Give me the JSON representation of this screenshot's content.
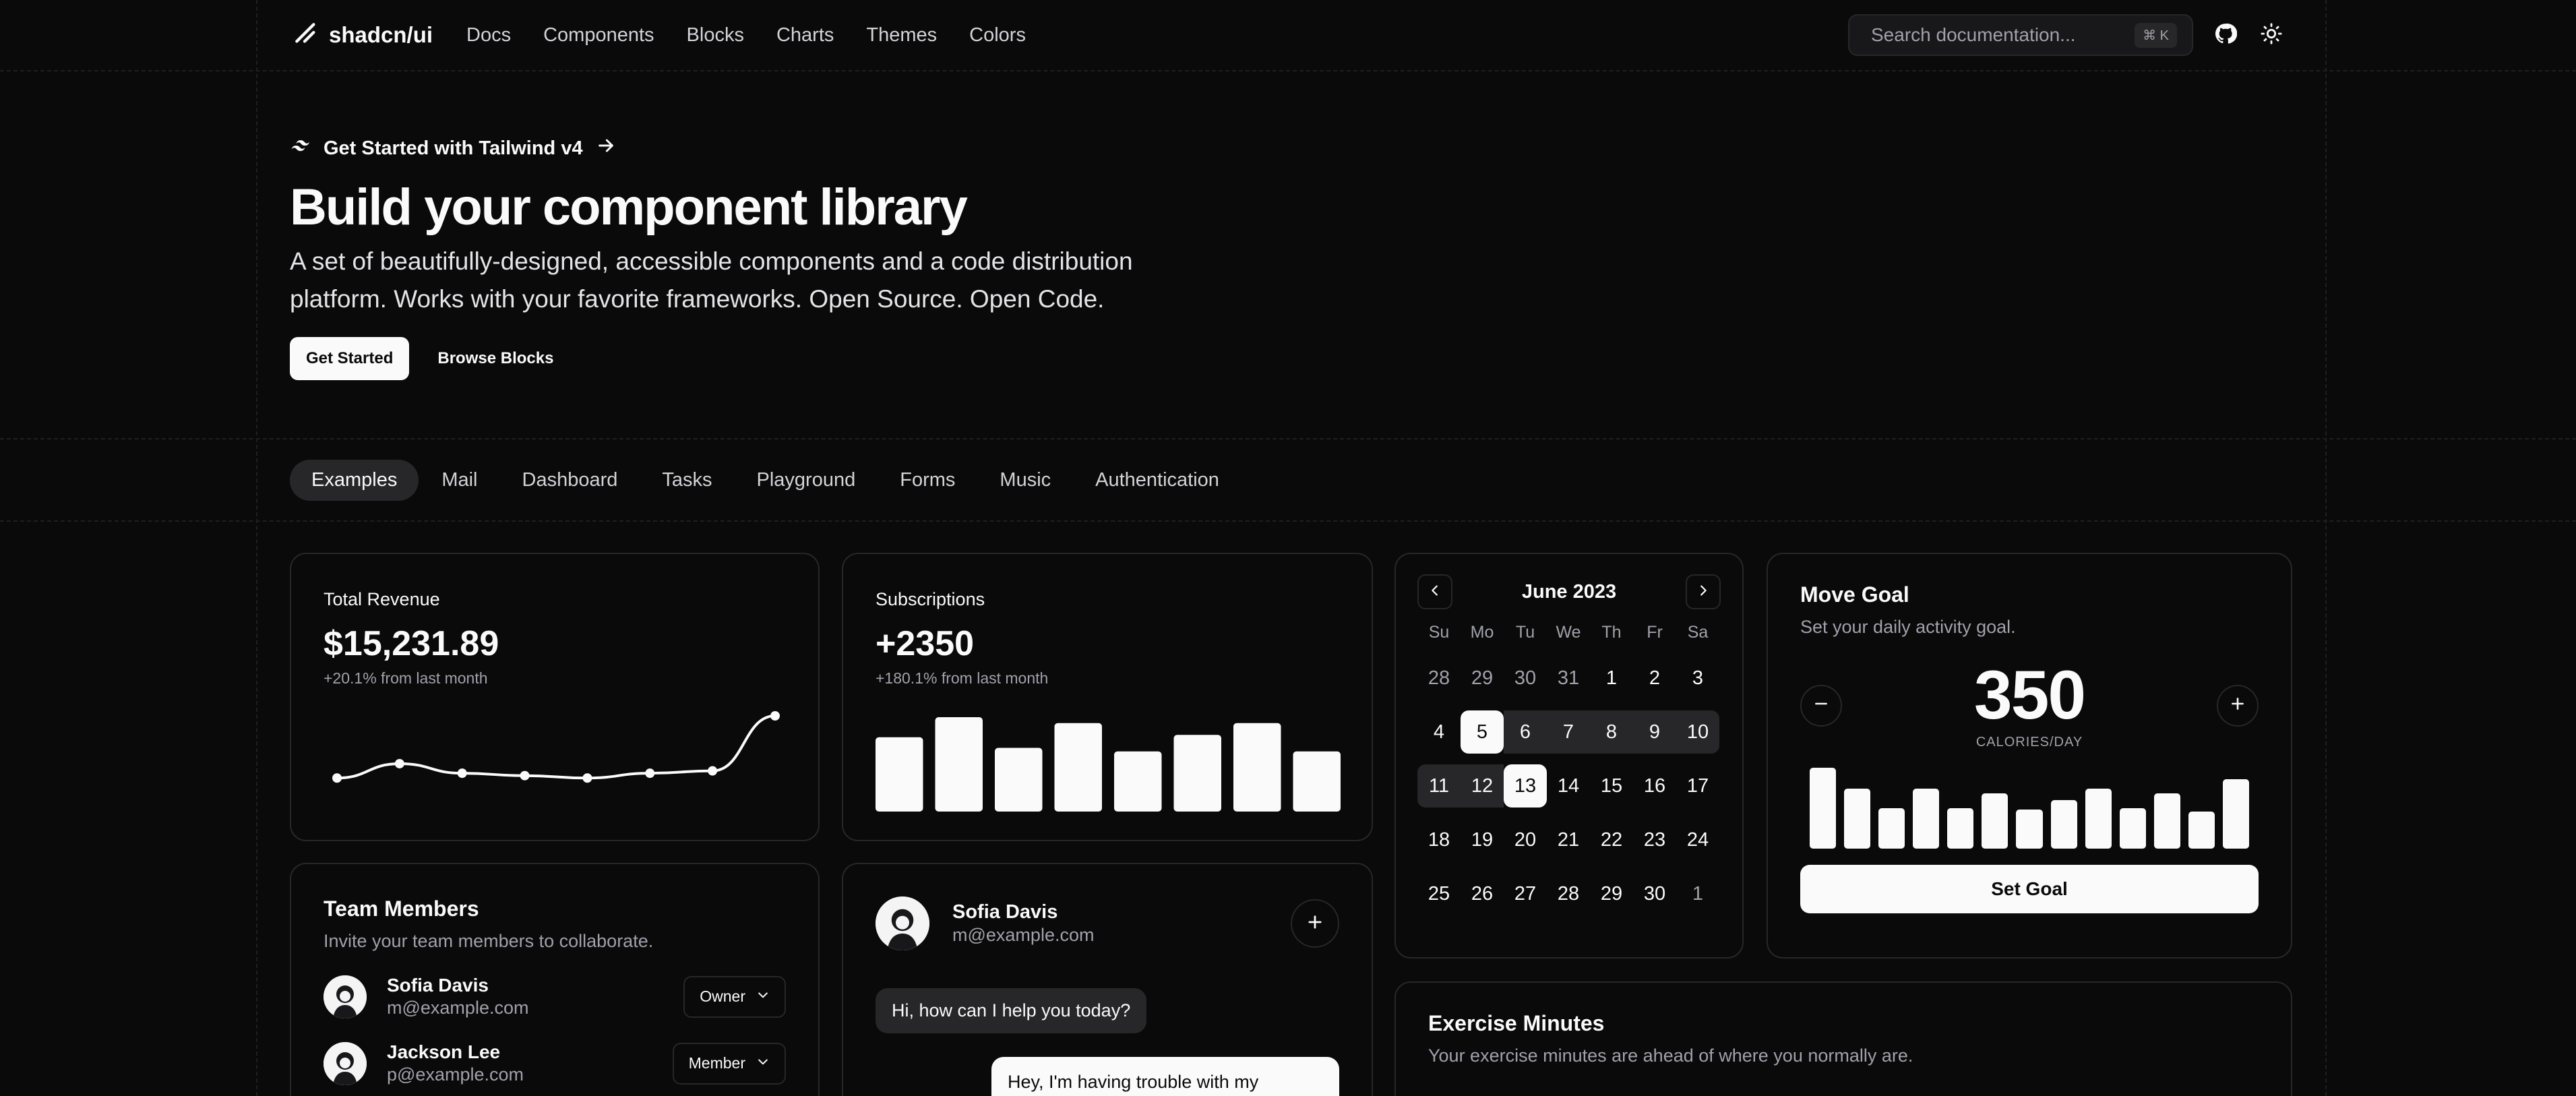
{
  "header": {
    "brand": "shadcn/ui",
    "nav": [
      "Docs",
      "Components",
      "Blocks",
      "Charts",
      "Themes",
      "Colors"
    ],
    "search_placeholder": "Search documentation...",
    "search_kbd": "⌘ K"
  },
  "hero": {
    "announcement": "Get Started with Tailwind v4",
    "title": "Build your component library",
    "description": "A set of beautifully-designed, accessible components and a code distribution platform. Works with your favorite frameworks. Open Source. Open Code.",
    "primary_button": "Get Started",
    "secondary_button": "Browse Blocks"
  },
  "tabs": [
    "Examples",
    "Mail",
    "Dashboard",
    "Tasks",
    "Playground",
    "Forms",
    "Music",
    "Authentication"
  ],
  "revenue": {
    "label": "Total Revenue",
    "value": "$15,231.89",
    "change": "+20.1% from last month",
    "trend": [
      10,
      22,
      14,
      12,
      10,
      14,
      16,
      62
    ]
  },
  "subscriptions": {
    "label": "Subscriptions",
    "value": "+2350",
    "change": "+180.1% from last month",
    "bars": [
      63,
      80,
      54,
      75,
      51,
      65,
      75,
      51
    ]
  },
  "calendar": {
    "month": "June 2023",
    "weekdays": [
      "Su",
      "Mo",
      "Tu",
      "We",
      "Th",
      "Fr",
      "Sa"
    ],
    "days": [
      {
        "d": "28",
        "s": "muted"
      },
      {
        "d": "29",
        "s": "muted"
      },
      {
        "d": "30",
        "s": "muted"
      },
      {
        "d": "31",
        "s": "muted"
      },
      {
        "d": "1",
        "s": ""
      },
      {
        "d": "2",
        "s": ""
      },
      {
        "d": "3",
        "s": ""
      },
      {
        "d": "4",
        "s": ""
      },
      {
        "d": "5",
        "s": "sel"
      },
      {
        "d": "6",
        "s": "range"
      },
      {
        "d": "7",
        "s": "range"
      },
      {
        "d": "8",
        "s": "range"
      },
      {
        "d": "9",
        "s": "range"
      },
      {
        "d": "10",
        "s": "range range-end"
      },
      {
        "d": "11",
        "s": "range range-start"
      },
      {
        "d": "12",
        "s": "range"
      },
      {
        "d": "13",
        "s": "sel"
      },
      {
        "d": "14",
        "s": ""
      },
      {
        "d": "15",
        "s": ""
      },
      {
        "d": "16",
        "s": ""
      },
      {
        "d": "17",
        "s": ""
      },
      {
        "d": "18",
        "s": ""
      },
      {
        "d": "19",
        "s": ""
      },
      {
        "d": "20",
        "s": ""
      },
      {
        "d": "21",
        "s": ""
      },
      {
        "d": "22",
        "s": ""
      },
      {
        "d": "23",
        "s": ""
      },
      {
        "d": "24",
        "s": ""
      },
      {
        "d": "25",
        "s": ""
      },
      {
        "d": "26",
        "s": ""
      },
      {
        "d": "27",
        "s": ""
      },
      {
        "d": "28",
        "s": ""
      },
      {
        "d": "29",
        "s": ""
      },
      {
        "d": "30",
        "s": ""
      },
      {
        "d": "1",
        "s": "muted"
      }
    ]
  },
  "move_goal": {
    "title": "Move Goal",
    "description": "Set your daily activity goal.",
    "value": "350",
    "unit": "CALORIES/DAY",
    "bars": [
      100,
      74,
      50,
      74,
      50,
      68,
      48,
      60,
      74,
      50,
      68,
      46,
      86
    ],
    "button": "Set Goal"
  },
  "team": {
    "title": "Team Members",
    "description": "Invite your team members to collaborate.",
    "members": [
      {
        "name": "Sofia Davis",
        "email": "m@example.com",
        "role": "Owner"
      },
      {
        "name": "Jackson Lee",
        "email": "p@example.com",
        "role": "Member"
      }
    ]
  },
  "chat": {
    "name": "Sofia Davis",
    "email": "m@example.com",
    "incoming": "Hi, how can I help you today?",
    "outgoing": "Hey, I'm having trouble with my account."
  },
  "exercise": {
    "title": "Exercise Minutes",
    "description": "Your exercise minutes are ahead of where you normally are."
  }
}
